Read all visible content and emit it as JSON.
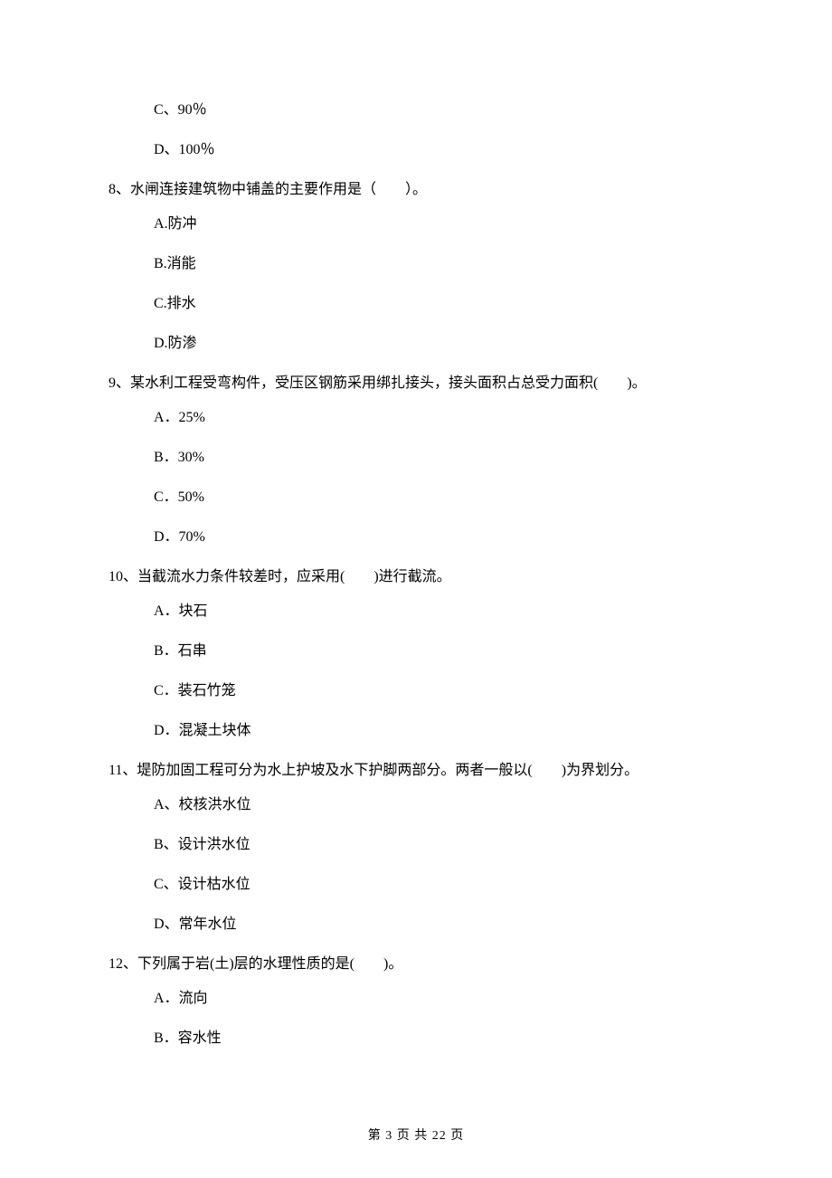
{
  "orphan_options": {
    "c": "C、90％",
    "d": "D、100％"
  },
  "questions": [
    {
      "num": "8、",
      "text": "水闸连接建筑物中铺盖的主要作用是（　　）。",
      "options": {
        "a": "A.防冲",
        "b": "B.消能",
        "c": "C.排水",
        "d": "D.防渗"
      }
    },
    {
      "num": "9、",
      "text": "某水利工程受弯构件，受压区钢筋采用绑扎接头，接头面积占总受力面积(　　)。",
      "options": {
        "a": "A．25%",
        "b": "B．30%",
        "c": "C．50%",
        "d": "D．70%"
      }
    },
    {
      "num": "10、",
      "text": "当截流水力条件较差时，应采用(　　)进行截流。",
      "options": {
        "a": "A．块石",
        "b": "B．石串",
        "c": "C．装石竹笼",
        "d": "D．混凝土块体"
      }
    },
    {
      "num": "11、",
      "text": "堤防加固工程可分为水上护坡及水下护脚两部分。两者一般以(　　)为界划分。",
      "options": {
        "a": "A、校核洪水位",
        "b": "B、设计洪水位",
        "c": "C、设计枯水位",
        "d": "D、常年水位"
      }
    },
    {
      "num": "12、",
      "text": "下列属于岩(土)层的水理性质的是(　　)。",
      "options": {
        "a": "A．流向",
        "b": "B．容水性"
      }
    }
  ],
  "page_number": "第 3 页 共 22 页"
}
